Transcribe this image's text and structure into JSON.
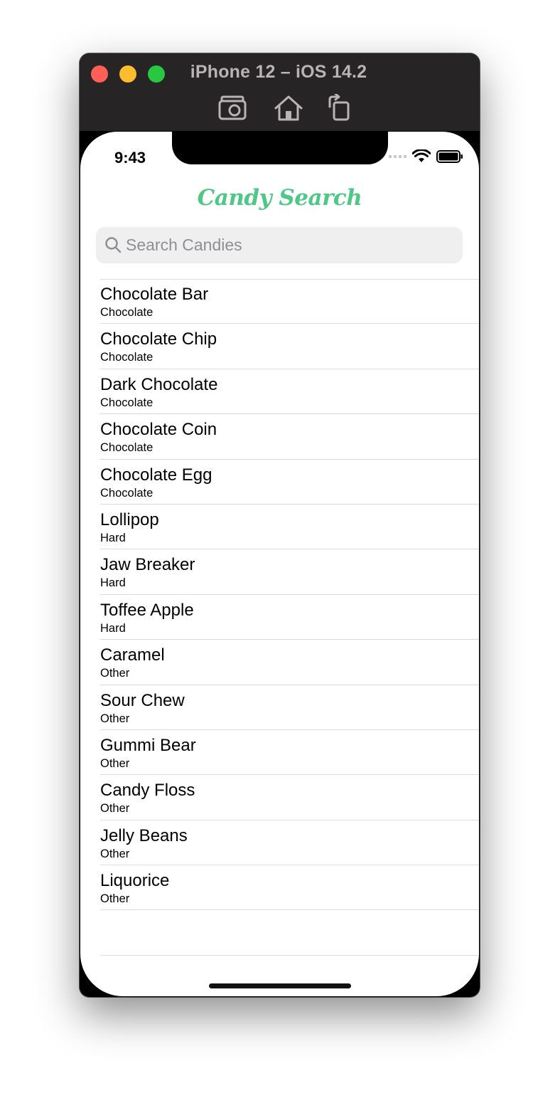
{
  "window": {
    "title": "iPhone 12 – iOS 14.2",
    "toolbar": [
      "screenshot-icon",
      "home-icon",
      "rotate-icon"
    ]
  },
  "status_bar": {
    "time": "9:43"
  },
  "nav": {
    "title": "Candy Search"
  },
  "search": {
    "placeholder": "Search Candies",
    "value": ""
  },
  "candies": [
    {
      "name": "Chocolate Bar",
      "category": "Chocolate"
    },
    {
      "name": "Chocolate Chip",
      "category": "Chocolate"
    },
    {
      "name": "Dark Chocolate",
      "category": "Chocolate"
    },
    {
      "name": "Chocolate Coin",
      "category": "Chocolate"
    },
    {
      "name": "Chocolate Egg",
      "category": "Chocolate"
    },
    {
      "name": "Lollipop",
      "category": "Hard"
    },
    {
      "name": "Jaw Breaker",
      "category": "Hard"
    },
    {
      "name": "Toffee Apple",
      "category": "Hard"
    },
    {
      "name": "Caramel",
      "category": "Other"
    },
    {
      "name": "Sour Chew",
      "category": "Other"
    },
    {
      "name": "Gummi Bear",
      "category": "Other"
    },
    {
      "name": "Candy Floss",
      "category": "Other"
    },
    {
      "name": "Jelly Beans",
      "category": "Other"
    },
    {
      "name": "Liquorice",
      "category": "Other"
    }
  ],
  "colors": {
    "accent": "#4fc786",
    "traffic_close": "#ff5f57",
    "traffic_minimize": "#febc2e",
    "traffic_maximize": "#28c840"
  }
}
